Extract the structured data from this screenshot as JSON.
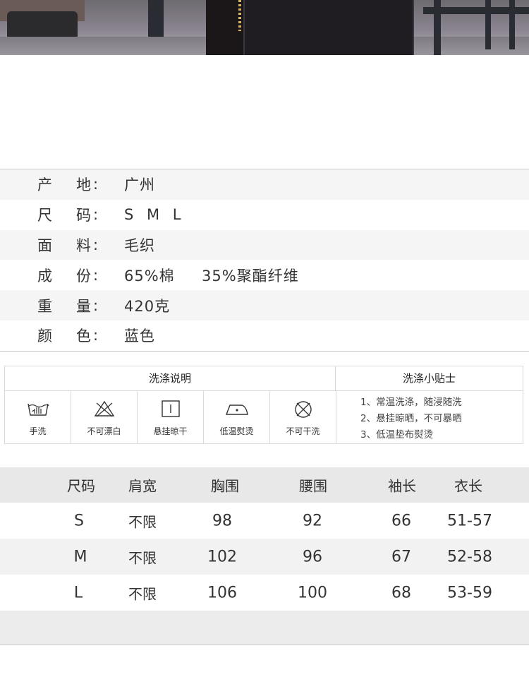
{
  "specs": [
    {
      "k1": "产",
      "k2": "地",
      "colon": ":",
      "value": "广州"
    },
    {
      "k1": "尺",
      "k2": "码",
      "colon": ":",
      "value": "S M L"
    },
    {
      "k1": "面",
      "k2": "料",
      "colon": ":",
      "value": "毛织"
    },
    {
      "k1": "成",
      "k2": "份",
      "colon": ":",
      "value": "65%棉     35%聚酯纤维"
    },
    {
      "k1": "重",
      "k2": "量",
      "colon": ":",
      "value": "420克"
    },
    {
      "k1": "颜",
      "k2": "色",
      "colon": ":",
      "value": "蓝色"
    }
  ],
  "care": {
    "title_left": "洗涤说明",
    "title_right": "洗涤小贴士",
    "icons": [
      {
        "icon": "hand-wash-icon",
        "label": "手洗"
      },
      {
        "icon": "no-bleach-icon",
        "label": "不可漂白"
      },
      {
        "icon": "hang-dry-icon",
        "label": "悬挂晾干"
      },
      {
        "icon": "low-iron-icon",
        "label": "低温熨烫"
      },
      {
        "icon": "no-dry-clean-icon",
        "label": "不可干洗"
      }
    ],
    "tips": [
      "1、常温洗涤，随浸随洗",
      "2、悬挂晾晒，不可暴晒",
      "3、低温垫布熨烫"
    ]
  },
  "size_chart": {
    "headers": [
      "尺码",
      "肩宽",
      "胸围",
      "腰围",
      "袖长",
      "衣长"
    ],
    "rows": [
      [
        "S",
        "不限",
        "98",
        "92",
        "66",
        "51-57"
      ],
      [
        "M",
        "不限",
        "102",
        "96",
        "67",
        "52-58"
      ],
      [
        "L",
        "不限",
        "106",
        "100",
        "68",
        "53-59"
      ]
    ]
  },
  "colors": {
    "row_stripe": "#f5f5f5",
    "header_bg": "#e8e8e8",
    "border": "#c9c9c9",
    "text": "#333333"
  }
}
